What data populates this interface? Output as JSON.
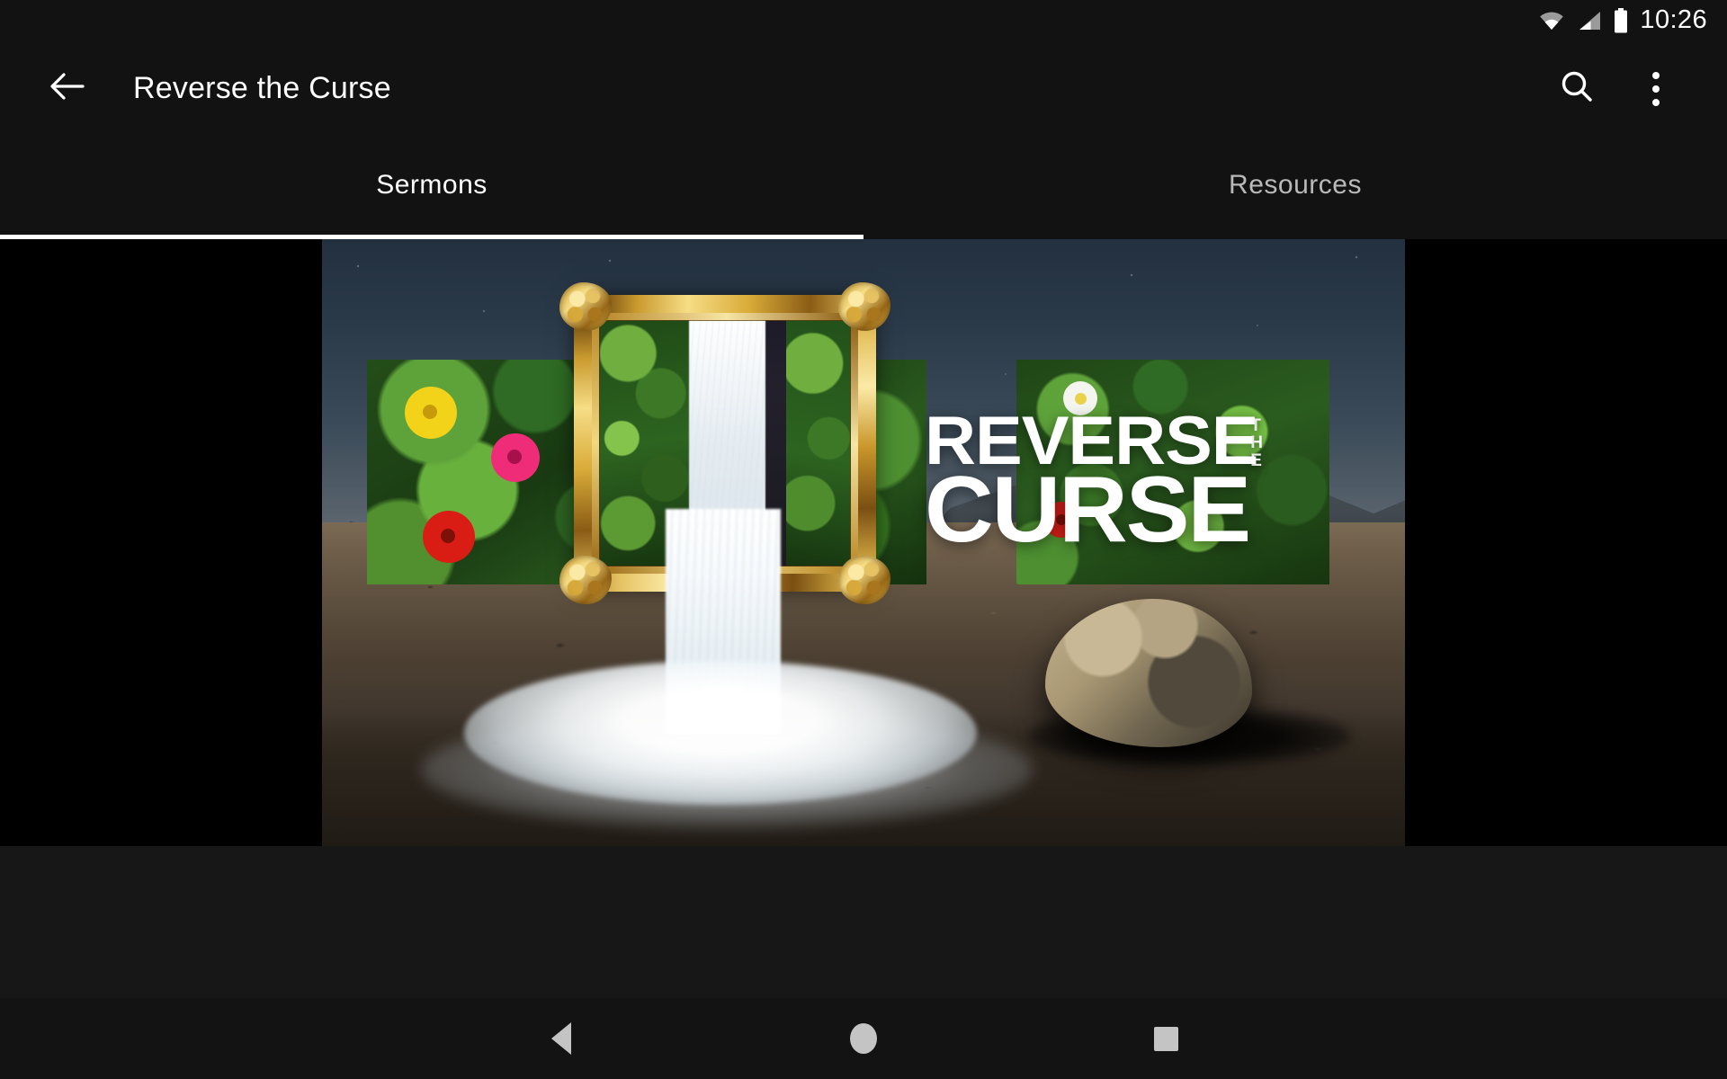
{
  "status_bar": {
    "time": "10:26",
    "icons": [
      "wifi-icon",
      "cellular-signal-icon",
      "battery-icon"
    ]
  },
  "app_bar": {
    "back_icon": "back-arrow-icon",
    "title": "Reverse the Curse",
    "search_icon": "search-icon",
    "overflow_icon": "overflow-menu-icon"
  },
  "tabs": {
    "items": [
      {
        "label": "Sermons",
        "active": true
      },
      {
        "label": "Resources",
        "active": false
      }
    ],
    "indicator_color": "#ffffff"
  },
  "hero": {
    "alt": "Reverse the Curse series artwork",
    "series_title_line1": "REVERSE",
    "series_title_the": [
      "T",
      "H",
      "E"
    ],
    "series_title_line2": "CURSE",
    "scene": {
      "background": "desert night with mountains and starry sky",
      "elements": [
        "gold-ornate-picture-frame",
        "waterfall",
        "green-foliage-wall",
        "flowers",
        "boulder",
        "water-pool"
      ]
    }
  },
  "nav_bar": {
    "back_label": "Back",
    "home_label": "Home",
    "recents_label": "Recents"
  },
  "colors": {
    "app_background": "#121212",
    "content_background": "#000000",
    "sheet": "#2d2d2d",
    "accent": "#ffffff",
    "tab_inactive": "#b9b9b9",
    "nav_icon": "#c4c4c4"
  }
}
